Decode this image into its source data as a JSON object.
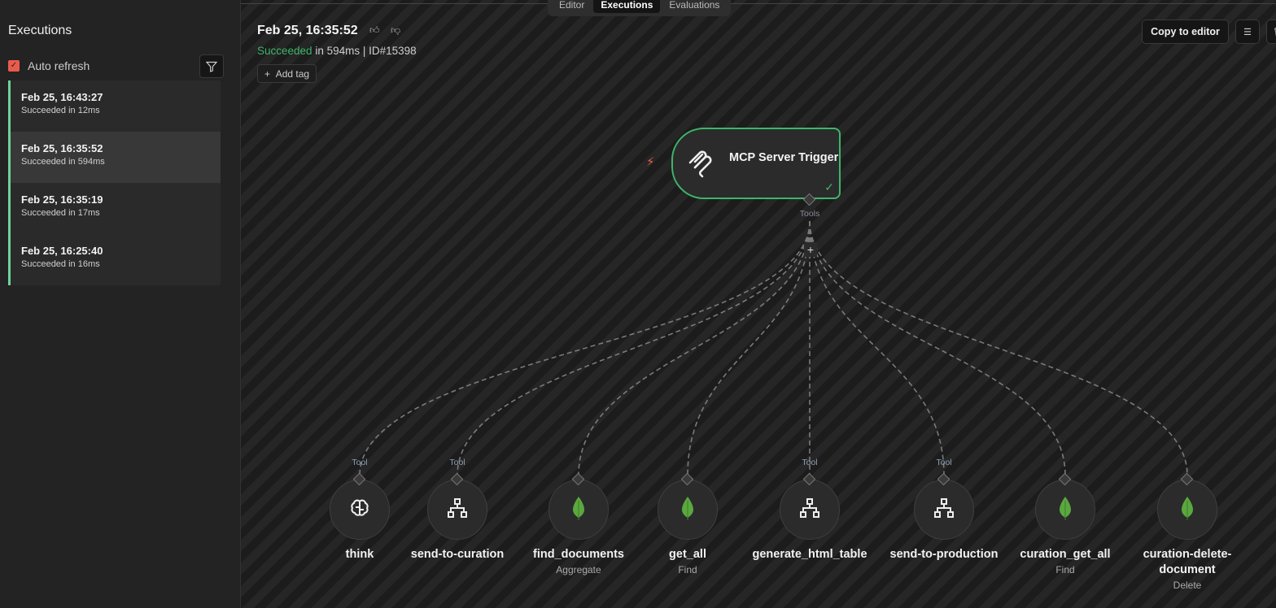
{
  "sidebar": {
    "title": "Executions",
    "auto_refresh": "Auto refresh",
    "auto_refresh_checked": true,
    "executions": [
      {
        "date": "Feb 25, 16:43:27",
        "status": "Succeeded in 12ms"
      },
      {
        "date": "Feb 25, 16:35:52",
        "status": "Succeeded in 594ms",
        "selected": true
      },
      {
        "date": "Feb 25, 16:35:19",
        "status": "Succeeded in 17ms"
      },
      {
        "date": "Feb 25, 16:25:40",
        "status": "Succeeded in 16ms"
      }
    ]
  },
  "tabs": [
    "Editor",
    "Executions",
    "Evaluations"
  ],
  "header": {
    "date": "Feb 25, 16:35:52",
    "status": "Succeeded",
    "duration": " in 594ms",
    "separator": " | ",
    "id": "ID#15398",
    "add_tag": "Add tag",
    "copy_to_editor": "Copy to editor"
  },
  "trigger": {
    "name": "MCP Server Trigger",
    "output_label": "Tools"
  },
  "tool_label": "Tool",
  "nodes": [
    {
      "name": "think",
      "sub": "",
      "tool": true,
      "icon": "brain"
    },
    {
      "name": "send-to-curation",
      "sub": "",
      "tool": true,
      "icon": "workflow"
    },
    {
      "name": "find_documents",
      "sub": "Aggregate",
      "tool": false,
      "icon": "mongodb"
    },
    {
      "name": "get_all",
      "sub": "Find",
      "tool": false,
      "icon": "mongodb"
    },
    {
      "name": "generate_html_table",
      "sub": "",
      "tool": true,
      "icon": "workflow"
    },
    {
      "name": "send-to-production",
      "sub": "",
      "tool": true,
      "icon": "workflow"
    },
    {
      "name": "curation_get_all",
      "sub": "Find",
      "tool": false,
      "icon": "mongodb"
    },
    {
      "name": "curation-delete-document",
      "sub": "Delete",
      "tool": false,
      "icon": "mongodb"
    }
  ],
  "colors": {
    "success": "#3fb56a",
    "accent": "#ea5b4d"
  }
}
